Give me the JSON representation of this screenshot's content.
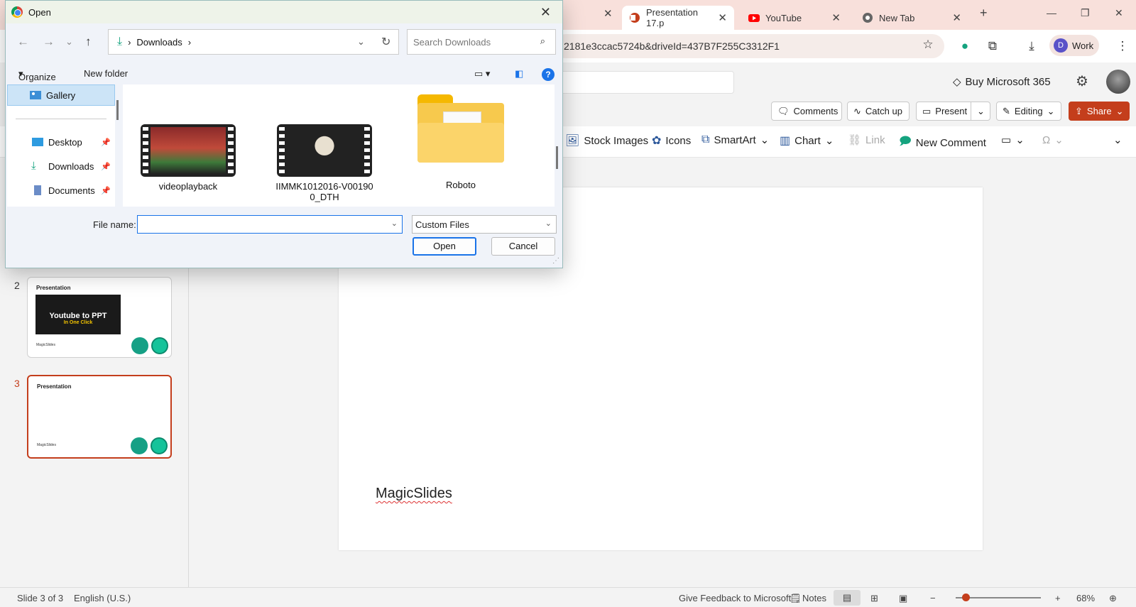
{
  "browser": {
    "tabs": [
      {
        "label": "Presentation 17.p",
        "active": true
      },
      {
        "label": "YouTube",
        "active": false
      },
      {
        "label": "New Tab",
        "active": false
      }
    ],
    "new_tab": "+",
    "url": "2181e3ccac5724b&driveId=437B7F255C3312F1",
    "profile_initial": "D",
    "profile_label": "Work"
  },
  "ppt": {
    "buy_label": "Buy Microsoft 365",
    "cmd": {
      "comments": "Comments",
      "catchup": "Catch up",
      "present": "Present",
      "editing": "Editing",
      "share": "Share"
    },
    "ribbon": {
      "stock_images": "Stock Images",
      "icons": "Icons",
      "smartart": "SmartArt",
      "chart": "Chart",
      "link": "Link",
      "new_comment": "New Comment"
    },
    "slides": [
      {
        "num": "2",
        "title": "Presentation",
        "banner_line1": "Youtube to PPT",
        "banner_line2": "In One Click",
        "footer": "MagicSlides"
      },
      {
        "num": "3",
        "title": "Presentation",
        "footer": "MagicSlides"
      }
    ],
    "canvas_text": "MagicSlides",
    "status": {
      "slide_info": "Slide 3 of 3",
      "language": "English (U.S.)",
      "feedback": "Give Feedback to Microsoft",
      "notes": "Notes",
      "zoom": "68%"
    }
  },
  "dialog": {
    "title": "Open",
    "path_folder": "Downloads",
    "search_placeholder": "Search Downloads",
    "organize": "Organize",
    "new_folder": "New folder",
    "nav": {
      "gallery": "Gallery",
      "desktop": "Desktop",
      "downloads": "Downloads",
      "documents": "Documents"
    },
    "files": [
      {
        "name": "videoplayback"
      },
      {
        "name": "IIMMK1012016-V001900_DTH"
      },
      {
        "name": "Roboto"
      }
    ],
    "filename_label": "File name:",
    "filename_value": "",
    "filetype": "Custom Files",
    "open_btn": "Open",
    "cancel_btn": "Cancel"
  }
}
